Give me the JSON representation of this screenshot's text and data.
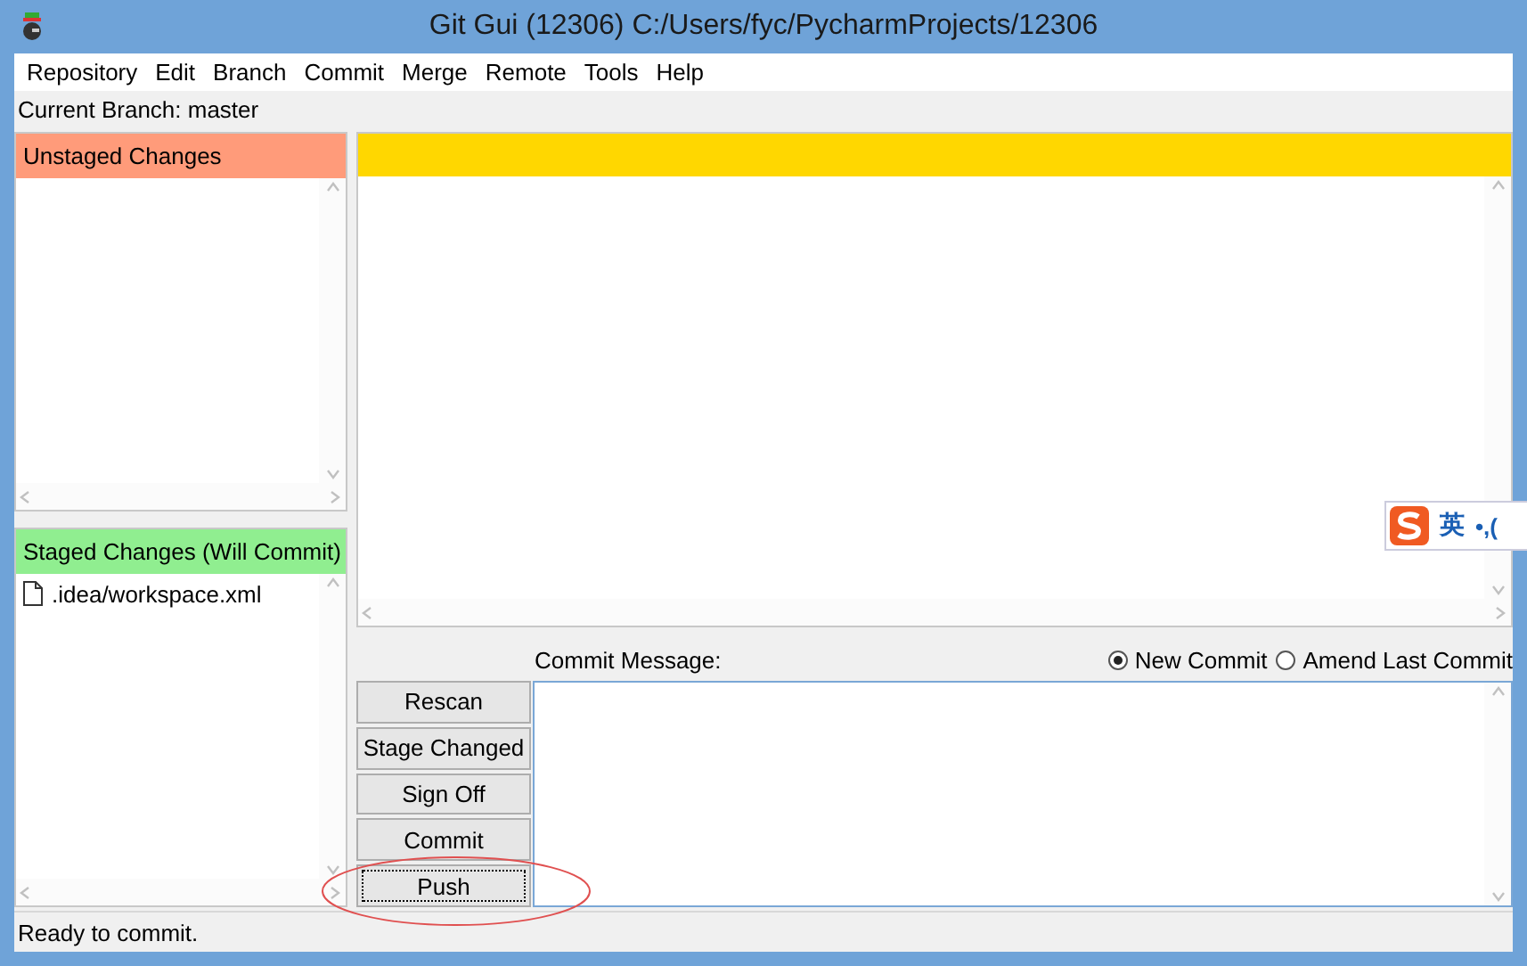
{
  "window": {
    "title": "Git Gui (12306) C:/Users/fyc/PycharmProjects/12306"
  },
  "menu": [
    "Repository",
    "Edit",
    "Branch",
    "Commit",
    "Merge",
    "Remote",
    "Tools",
    "Help"
  ],
  "current_branch": "Current Branch: master",
  "unstaged": {
    "title": "Unstaged Changes"
  },
  "staged": {
    "title": "Staged Changes (Will Commit)",
    "files": [
      ".idea/workspace.xml"
    ]
  },
  "commit_message": {
    "label": "Commit Message:"
  },
  "commit_modes": [
    {
      "label": "New Commit",
      "selected": true
    },
    {
      "label": "Amend Last Commit",
      "selected": false
    }
  ],
  "buttons": [
    {
      "label": "Rescan",
      "focused": false
    },
    {
      "label": "Stage Changed",
      "focused": false
    },
    {
      "label": "Sign Off",
      "focused": false
    },
    {
      "label": "Commit",
      "focused": false
    },
    {
      "label": "Push",
      "focused": true
    }
  ],
  "ime": {
    "mode": "英",
    "symbols": "•,("
  },
  "status_bar": "Ready to commit."
}
